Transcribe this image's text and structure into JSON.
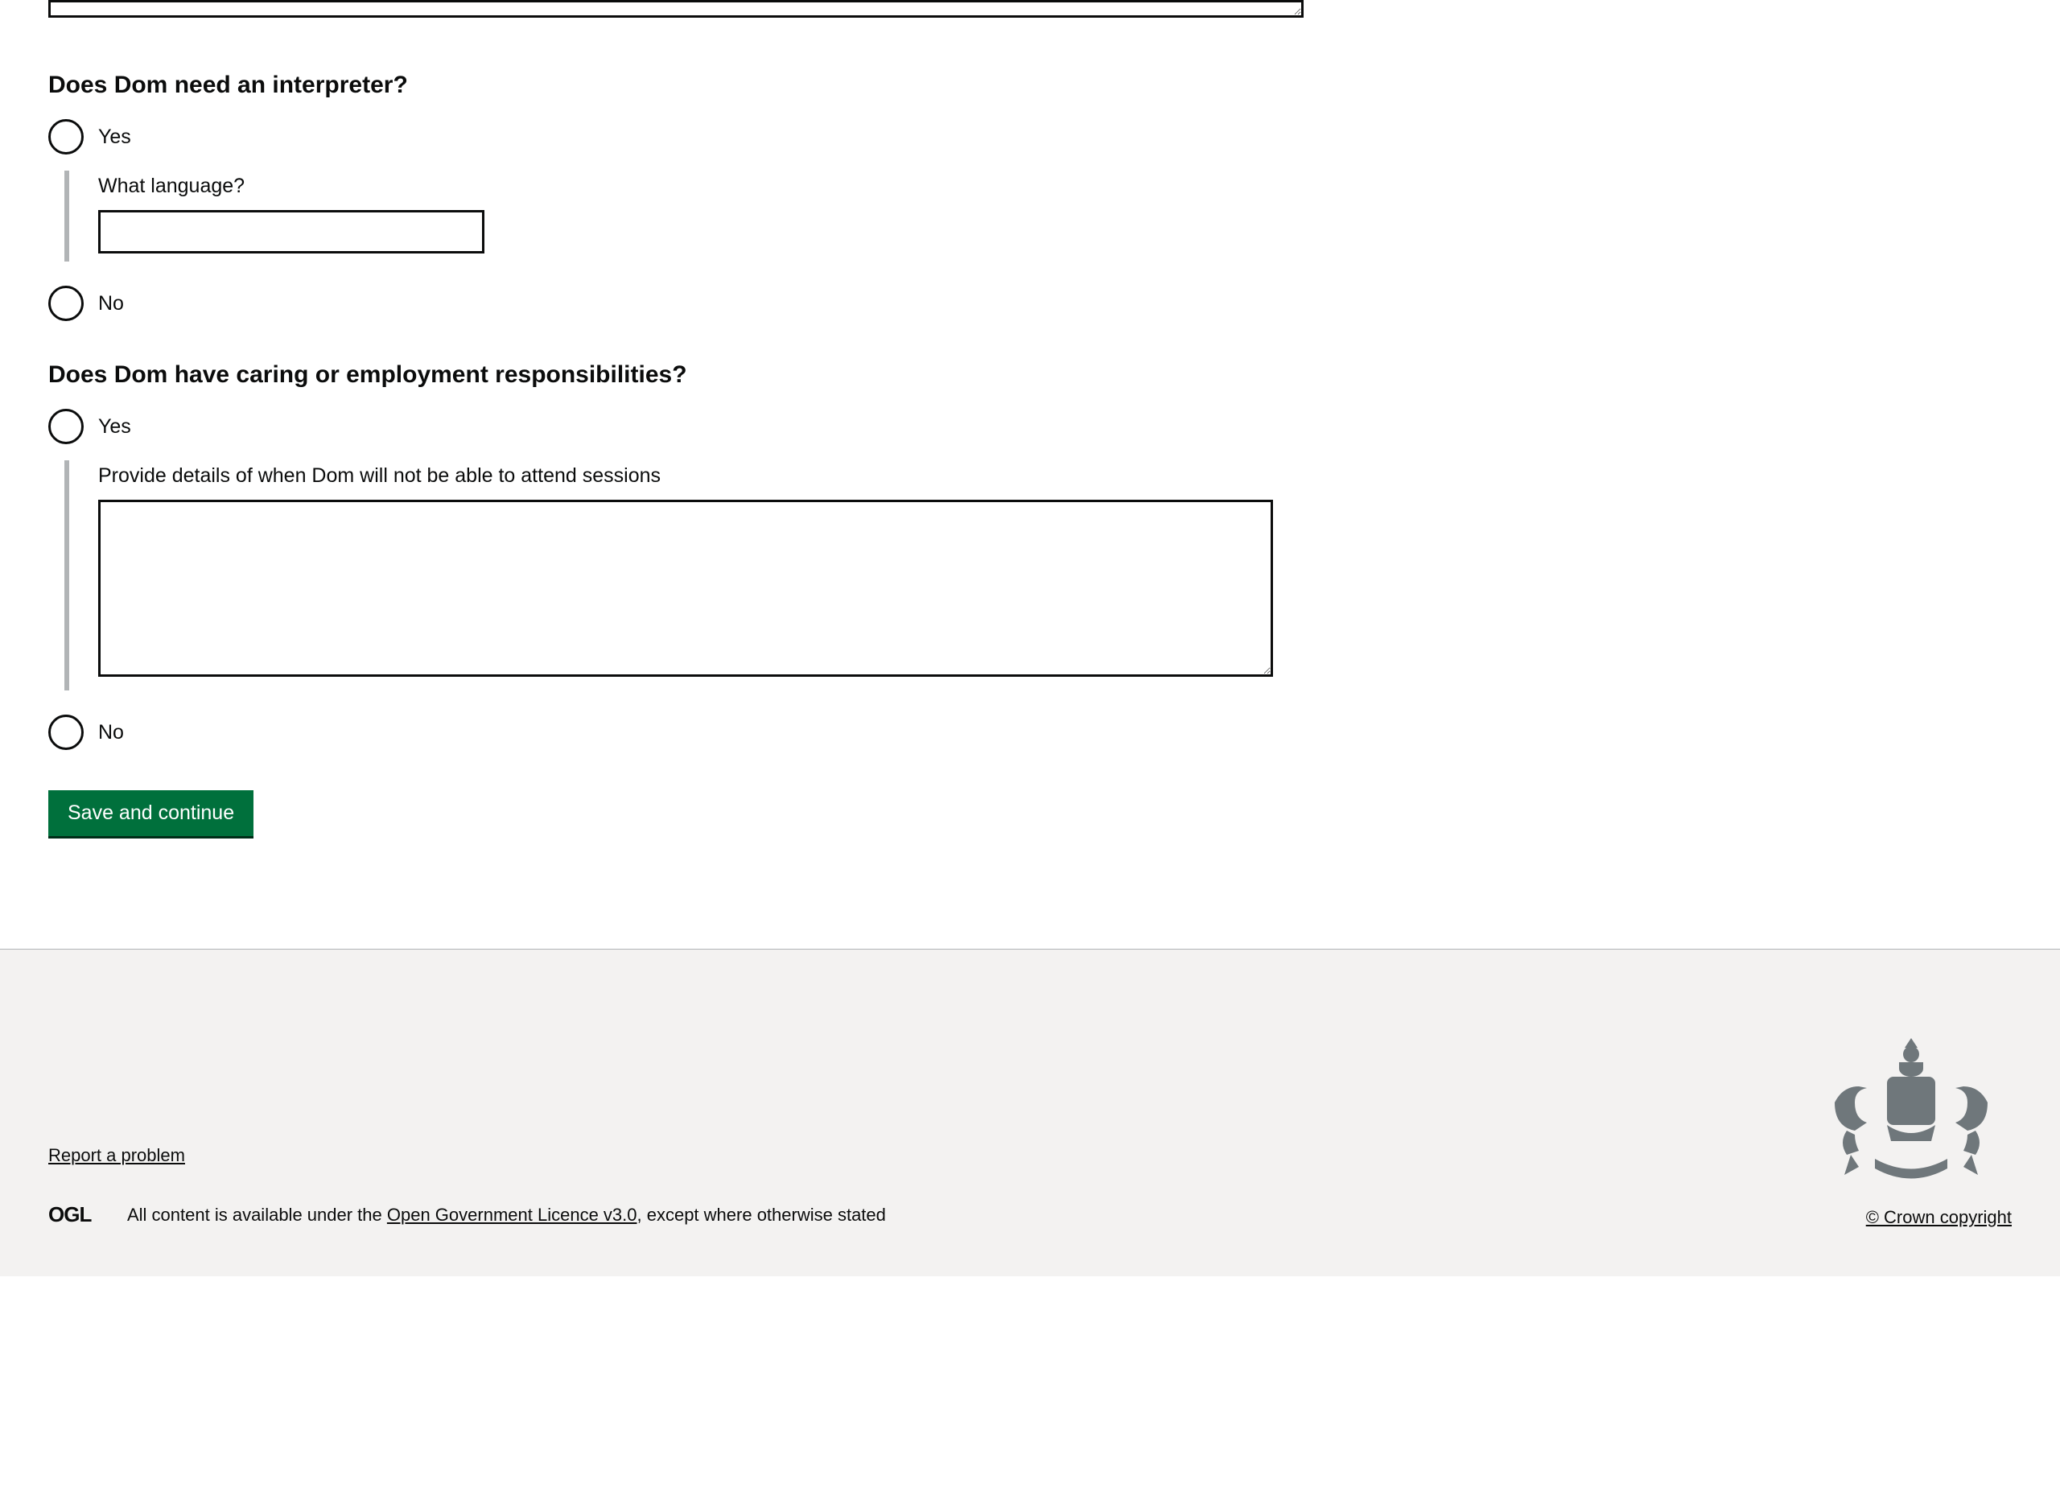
{
  "form": {
    "interpreter": {
      "legend": "Does Dom need an interpreter?",
      "yes_label": "Yes",
      "no_label": "No",
      "language_label": "What language?",
      "language_value": ""
    },
    "caring": {
      "legend": "Does Dom have caring or employment responsibilities?",
      "yes_label": "Yes",
      "no_label": "No",
      "details_label": "Provide details of when Dom will not be able to attend sessions",
      "details_value": ""
    },
    "submit_label": "Save and continue"
  },
  "footer": {
    "report_label": "Report a problem",
    "ogl_logo_text": "OGL",
    "licence_prefix": "All content is available under the ",
    "licence_link": "Open Government Licence v3.0",
    "licence_suffix": ", except where otherwise stated",
    "copyright": "© Crown copyright"
  }
}
